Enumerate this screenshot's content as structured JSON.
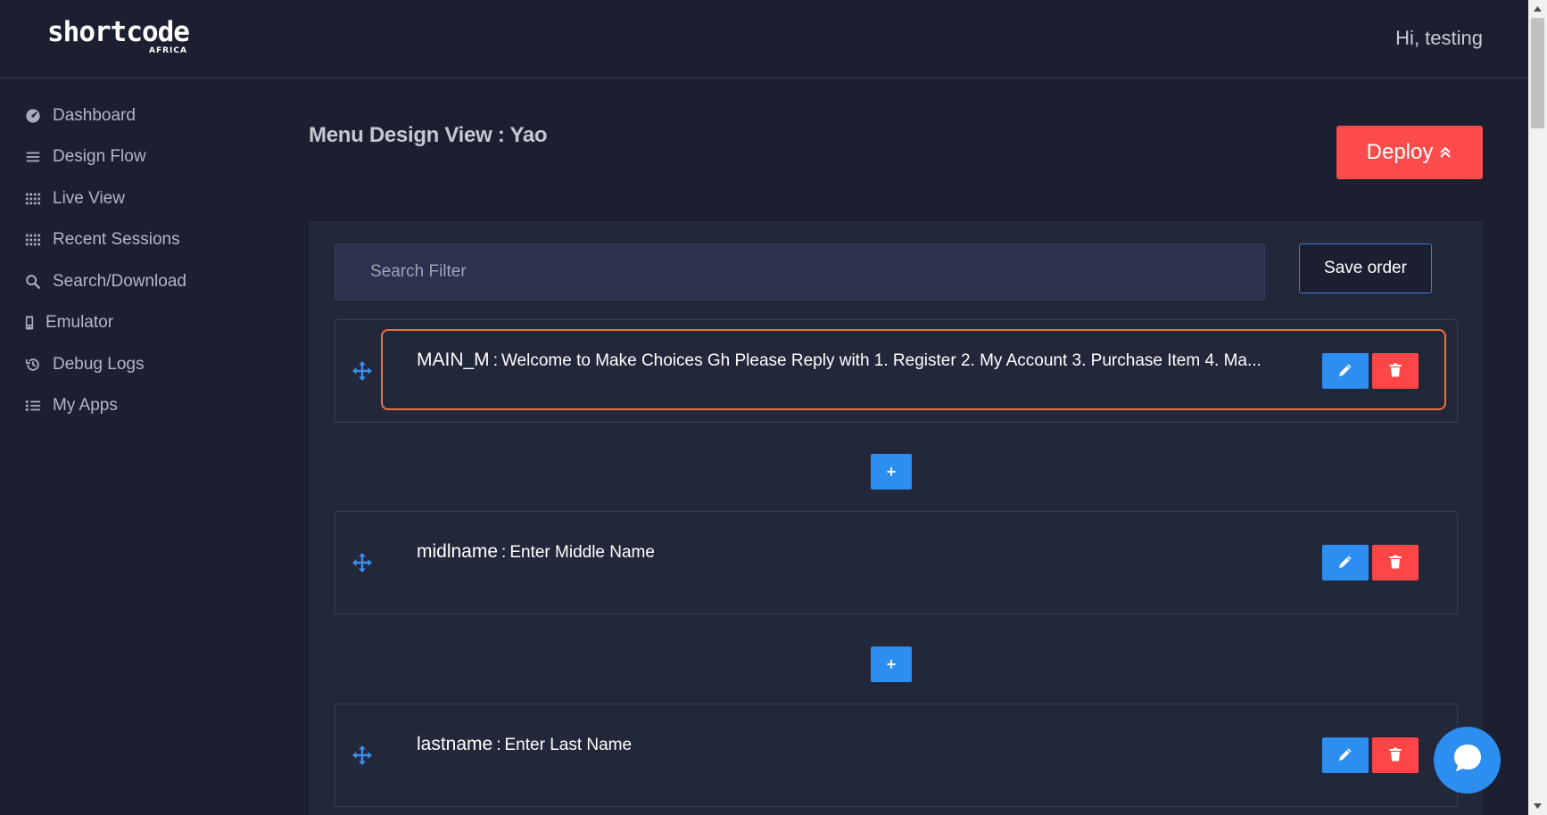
{
  "header": {
    "logo_main": "shortcode",
    "logo_sub": "AFRICA",
    "greeting": "Hi, testing"
  },
  "sidebar": {
    "items": [
      {
        "label": "Dashboard",
        "icon": "dashboard-icon"
      },
      {
        "label": "Design Flow",
        "icon": "bars-icon"
      },
      {
        "label": "Live View",
        "icon": "grid-icon"
      },
      {
        "label": "Recent Sessions",
        "icon": "grid-icon"
      },
      {
        "label": "Search/Download",
        "icon": "search-icon"
      },
      {
        "label": "Emulator",
        "icon": "phone-icon"
      },
      {
        "label": "Debug Logs",
        "icon": "history-icon"
      },
      {
        "label": "My Apps",
        "icon": "list-icon"
      }
    ]
  },
  "main": {
    "title": "Menu Design View : Yao",
    "deploy_label": "Deploy",
    "search_placeholder": "Search Filter",
    "save_order_label": "Save order",
    "add_label": "+",
    "menus": [
      {
        "id": "MAIN_M",
        "separator": ":",
        "text": "Welcome to Make Choices Gh Please Reply with 1. Register 2. My Account 3. Purchase Item 4. Ma...",
        "highlighted": true
      },
      {
        "id": "midlname",
        "separator": ":",
        "text": "Enter Middle Name",
        "highlighted": false
      },
      {
        "id": "lastname",
        "separator": ":",
        "text": "Enter Last Name",
        "highlighted": false
      }
    ]
  },
  "colors": {
    "background": "#1c1f30",
    "panel": "#23273a",
    "accent_blue": "#2b8ef0",
    "danger_red": "#ff4545",
    "highlight_orange": "#f07238"
  }
}
